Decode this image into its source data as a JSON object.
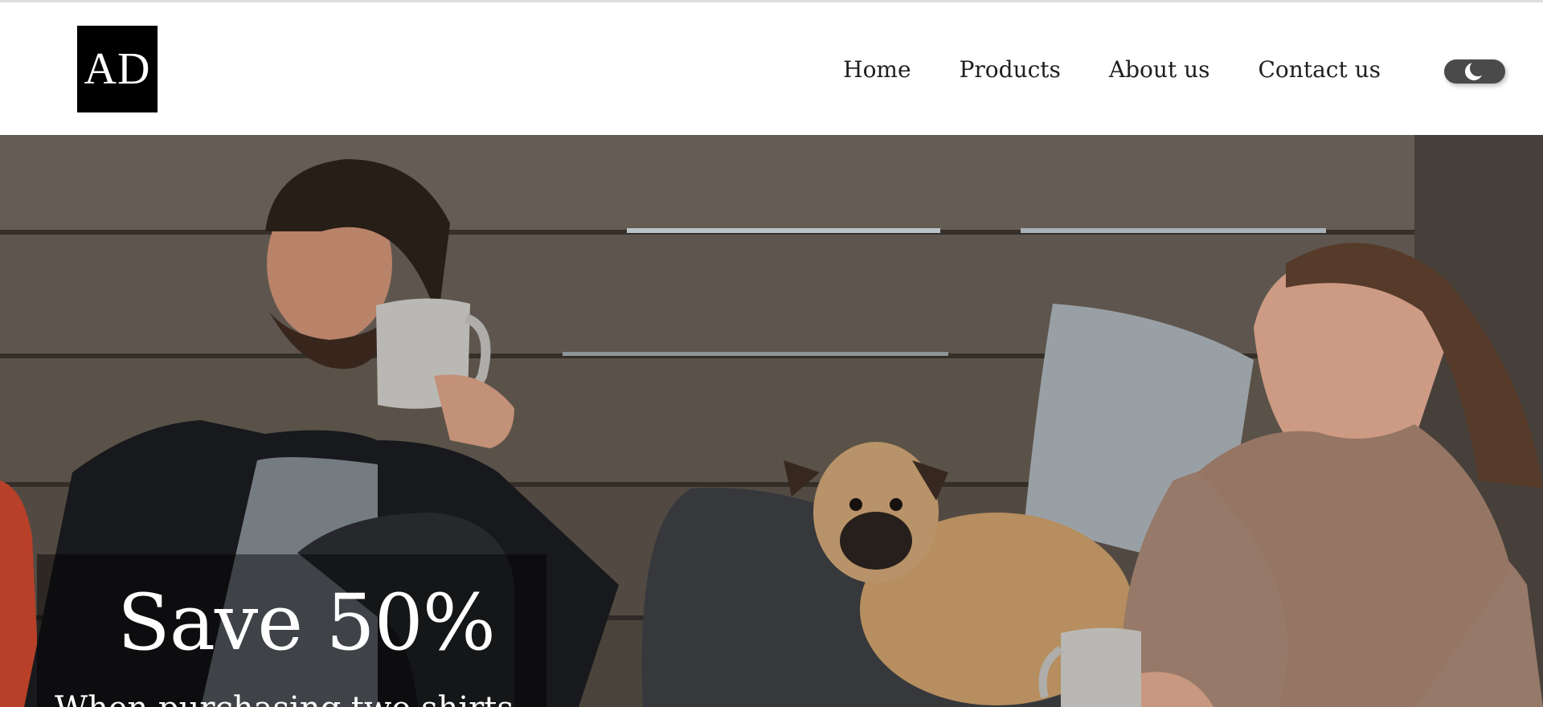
{
  "brand": {
    "logo_text": "AD"
  },
  "nav": {
    "items": [
      {
        "label": "Home"
      },
      {
        "label": "Products"
      },
      {
        "label": "About us"
      },
      {
        "label": "Contact us"
      }
    ]
  },
  "theme_toggle": {
    "icon": "moon-icon",
    "state": "dark"
  },
  "hero": {
    "image": "photo of two people and a pug sitting against a wooden fence",
    "promo": {
      "title": "Save 50%",
      "subtitle": "When purchasing two shirts"
    }
  },
  "colors": {
    "logo_bg": "#000000",
    "toggle_bg": "#4a4a4a",
    "nav_text": "#1f1f1f",
    "promo_text": "#ffffff"
  }
}
